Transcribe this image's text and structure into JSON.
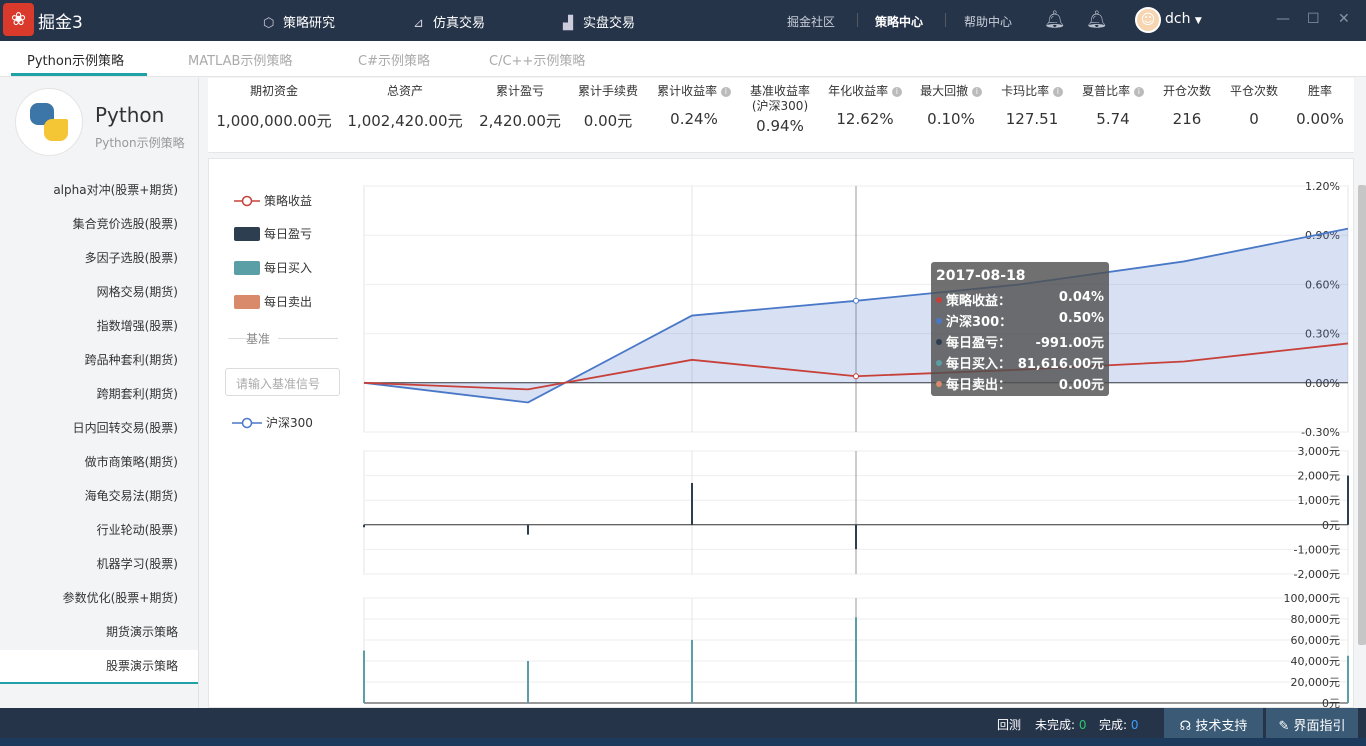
{
  "app": {
    "logo_text": "❀",
    "name": "掘金3"
  },
  "nav": [
    {
      "icon": "cube-icon",
      "label": "策略研究"
    },
    {
      "icon": "trend-chart-icon",
      "label": "仿真交易"
    },
    {
      "icon": "bar-chart-icon",
      "label": "实盘交易"
    }
  ],
  "header_links": {
    "community": "掘金社区",
    "strategy_center": "策略中心",
    "help": "帮助中心"
  },
  "user": {
    "name": "dch"
  },
  "tabs": [
    "Python示例策略",
    "MATLAB示例策略",
    "C#示例策略",
    "C/C++示例策略"
  ],
  "sidebar": {
    "title": "Python",
    "subtitle": "Python示例策略",
    "items": [
      "alpha对冲(股票+期货)",
      "集合竞价选股(股票)",
      "多因子选股(股票)",
      "网格交易(期货)",
      "指数增强(股票)",
      "跨品种套利(期货)",
      "跨期套利(期货)",
      "日内回转交易(股票)",
      "做市商策略(期货)",
      "海龟交易法(期货)",
      "行业轮动(股票)",
      "机器学习(股票)",
      "参数优化(股票+期货)",
      "期货演示策略",
      "股票演示策略"
    ]
  },
  "stats": [
    {
      "label": "期初资金",
      "value": "1,000,000.00元"
    },
    {
      "label": "总资产",
      "value": "1,002,420.00元"
    },
    {
      "label": "累计盈亏",
      "value": "2,420.00元"
    },
    {
      "label": "累计手续费",
      "value": "0.00元"
    },
    {
      "label": "累计收益率",
      "value": "0.24%"
    },
    {
      "label": "基准收益率",
      "label2": "(沪深300)",
      "value": "0.94%"
    },
    {
      "label": "年化收益率",
      "value": "12.62%"
    },
    {
      "label": "最大回撤",
      "value": "0.10%"
    },
    {
      "label": "卡玛比率",
      "value": "127.51"
    },
    {
      "label": "夏普比率",
      "value": "5.74"
    },
    {
      "label": "开仓次数",
      "value": "216"
    },
    {
      "label": "平仓次数",
      "value": "0"
    },
    {
      "label": "胜率",
      "value": "0.00%"
    }
  ],
  "legend": {
    "strategy": "策略收益",
    "daily_pnl": "每日盈亏",
    "daily_buy": "每日买入",
    "daily_sell": "每日卖出",
    "benchmark_title": "基准",
    "benchmark_placeholder": "请输入基准信号",
    "benchmark": "沪深300"
  },
  "colors": {
    "strategy": "#c8403a",
    "benchmark": "#4a78c8",
    "pnl": "#2c3e50",
    "buy": "#5a9ea6",
    "sell": "#d98a6a",
    "accent": "#1ea2a8"
  },
  "chart_data": [
    {
      "type": "line",
      "y_ticks": [
        "1.20%",
        "0.90%",
        "0.60%",
        "0.30%",
        "0.00%",
        "-0.30%"
      ],
      "ylim": [
        -0.3,
        1.2
      ],
      "x_points": 7,
      "series": [
        {
          "name": "策略收益",
          "values": [
            0.0,
            -0.04,
            0.14,
            0.04,
            0.08,
            0.13,
            0.24
          ]
        },
        {
          "name": "沪深300",
          "values": [
            0.0,
            -0.12,
            0.41,
            0.5,
            0.6,
            0.74,
            0.94
          ]
        }
      ]
    },
    {
      "type": "bar",
      "y_ticks": [
        "3,000元",
        "2,000元",
        "1,000元",
        "0元",
        "-1,000元",
        "-2,000元"
      ],
      "ylim": [
        -2000,
        3000
      ],
      "series": [
        {
          "name": "每日盈亏",
          "values": [
            -100,
            -400,
            1700,
            -991,
            0,
            0,
            2000
          ]
        }
      ]
    },
    {
      "type": "bar",
      "y_ticks": [
        "100,000元",
        "80,000元",
        "60,000元",
        "40,000元",
        "20,000元",
        "0元"
      ],
      "ylim": [
        0,
        100000
      ],
      "series": [
        {
          "name": "每日买入",
          "values": [
            50000,
            40000,
            60000,
            81616,
            0,
            0,
            45000
          ]
        }
      ]
    }
  ],
  "tooltip": {
    "date": "2017-08-18",
    "rows": [
      {
        "label": "策略收益：",
        "value": "0.04%",
        "color": "#c8403a"
      },
      {
        "label": "沪深300：",
        "value": "0.50%",
        "color": "#4a78c8"
      },
      {
        "label": "每日盈亏：",
        "value": "-991.00元",
        "color": "#2c3e50"
      },
      {
        "label": "每日买入：",
        "value": "81,616.00元",
        "color": "#5a9ea6"
      },
      {
        "label": "每日卖出：",
        "value": "0.00元",
        "color": "#d98a6a"
      }
    ]
  },
  "status": {
    "backtest": "回测",
    "unfinished": "未完成:",
    "unfinished_n": "0",
    "finished": "完成:",
    "finished_n": "0",
    "support": "技术支持",
    "guide": "界面指引"
  }
}
